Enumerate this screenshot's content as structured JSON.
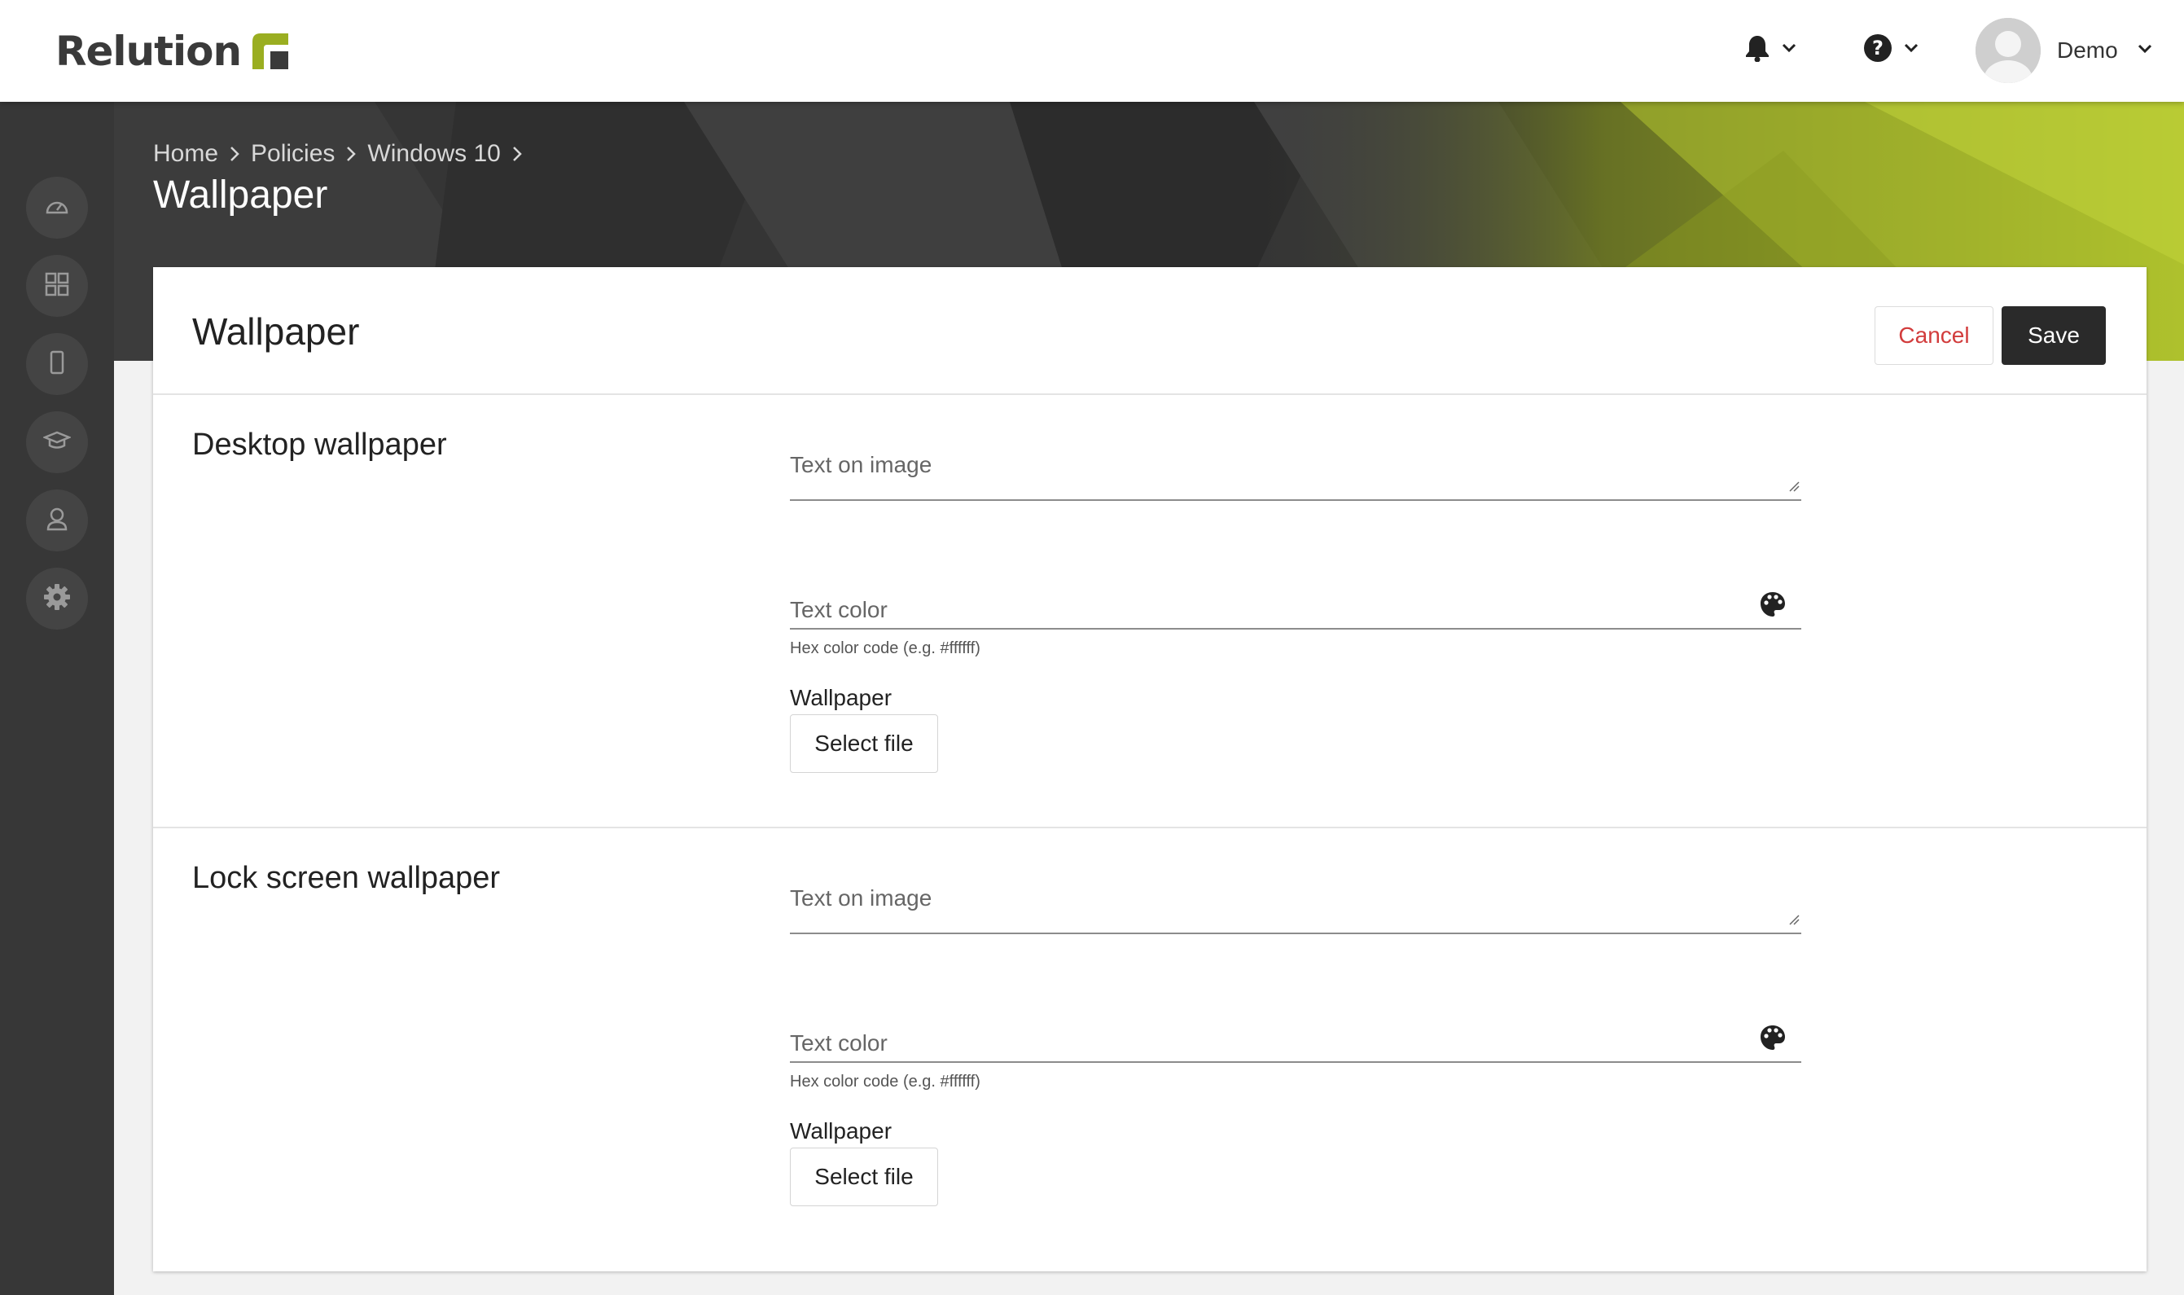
{
  "header": {
    "logo_text": "Relution",
    "user_name": "Demo",
    "accent_color": "#9aae21"
  },
  "sidebar": {
    "items": [
      {
        "icon": "dashboard-icon"
      },
      {
        "icon": "apps-grid-icon"
      },
      {
        "icon": "device-icon"
      },
      {
        "icon": "education-icon"
      },
      {
        "icon": "user-icon"
      },
      {
        "icon": "settings-gear-icon"
      }
    ]
  },
  "breadcrumb": {
    "items": [
      "Home",
      "Policies",
      "Windows 10"
    ],
    "title": "Wallpaper"
  },
  "card": {
    "title": "Wallpaper",
    "cancel_label": "Cancel",
    "save_label": "Save"
  },
  "sections": [
    {
      "title": "Desktop wallpaper",
      "text_on_image_label": "Text on image",
      "text_color_label": "Text color",
      "hint": "Hex color code (e.g. #ffffff)",
      "wallpaper_label": "Wallpaper",
      "select_file_label": "Select file"
    },
    {
      "title": "Lock screen wallpaper",
      "text_on_image_label": "Text on image",
      "text_color_label": "Text color",
      "hint": "Hex color code (e.g. #ffffff)",
      "wallpaper_label": "Wallpaper",
      "select_file_label": "Select file"
    }
  ]
}
